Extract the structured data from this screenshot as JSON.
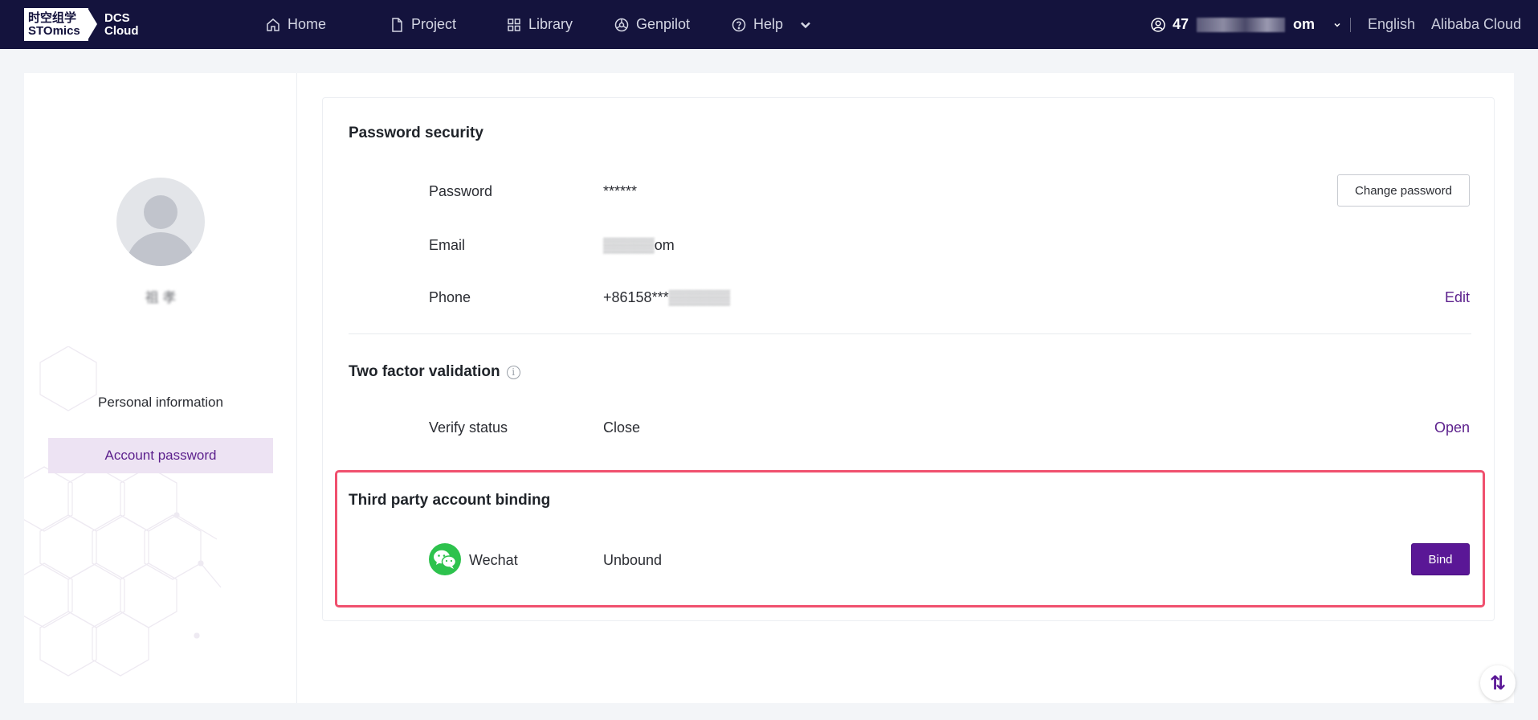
{
  "header": {
    "logo_cn": "时空组学",
    "logo_en": "STOmics",
    "logo_product_1": "DCS",
    "logo_product_2": "Cloud",
    "nav": {
      "home": "Home",
      "project": "Project",
      "library": "Library",
      "genpilot": "Genpilot",
      "help": "Help"
    },
    "user_prefix": "47",
    "user_suffix": "om",
    "language": "English",
    "cloud": "Alibaba Cloud"
  },
  "sidebar": {
    "username": "祖 孝",
    "items": {
      "personal": "Personal information",
      "account": "Account password"
    }
  },
  "password_security": {
    "title": "Password security",
    "password_label": "Password",
    "password_value": "******",
    "change_password_label": "Change password",
    "email_label": "Email",
    "email_value": "om",
    "phone_label": "Phone",
    "phone_value": "+86158***",
    "phone_edit_label": "Edit"
  },
  "two_factor": {
    "title": "Two factor validation",
    "info_glyph": "i",
    "verify_label": "Verify status",
    "verify_value": "Close",
    "open_label": "Open"
  },
  "third_party": {
    "title": "Third party account binding",
    "wechat_label": "Wechat",
    "wechat_status": "Unbound",
    "bind_label": "Bind"
  },
  "floating": {
    "glyph": "⇅"
  },
  "colors": {
    "header_bg": "#14133d",
    "accent": "#5a1796",
    "link": "#5b1f8c",
    "highlight_border": "#f0506e",
    "wechat_green": "#2dc24d",
    "active_menu_bg": "#ede3f3"
  }
}
